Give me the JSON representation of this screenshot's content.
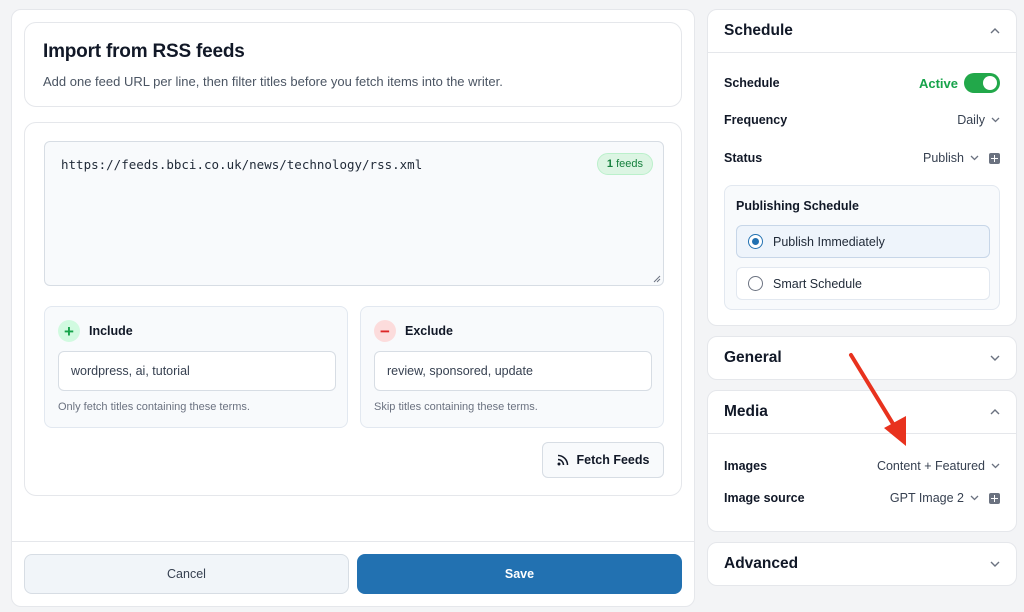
{
  "import": {
    "title": "Import from RSS feeds",
    "subtitle": "Add one feed URL per line, then filter titles before you fetch items into the writer.",
    "feed_urls": "https://feeds.bbci.co.uk/news/technology/rss.xml",
    "feeds_count": "1",
    "feeds_label": "feeds",
    "include": {
      "title": "Include",
      "value": "wordpress, ai, tutorial",
      "help": "Only fetch titles containing these terms."
    },
    "exclude": {
      "title": "Exclude",
      "value": "review, sponsored, update",
      "help": "Skip titles containing these terms."
    },
    "fetch_label": "Fetch Feeds",
    "cancel_label": "Cancel",
    "save_label": "Save"
  },
  "sidebar": {
    "schedule": {
      "title": "Schedule",
      "schedule_label": "Schedule",
      "schedule_state": "Active",
      "frequency_label": "Frequency",
      "frequency_value": "Daily",
      "status_label": "Status",
      "status_value": "Publish",
      "publishing_title": "Publishing Schedule",
      "option_immediate": "Publish Immediately",
      "option_smart": "Smart Schedule",
      "selected": "Publish Immediately"
    },
    "general": {
      "title": "General"
    },
    "media": {
      "title": "Media",
      "images_label": "Images",
      "images_value": "Content + Featured",
      "source_label": "Image source",
      "source_value": "GPT Image 2"
    },
    "advanced": {
      "title": "Advanced"
    }
  },
  "colors": {
    "accent": "#2271b1",
    "active_green": "#16a34a",
    "arrow_red": "#e8321e"
  }
}
